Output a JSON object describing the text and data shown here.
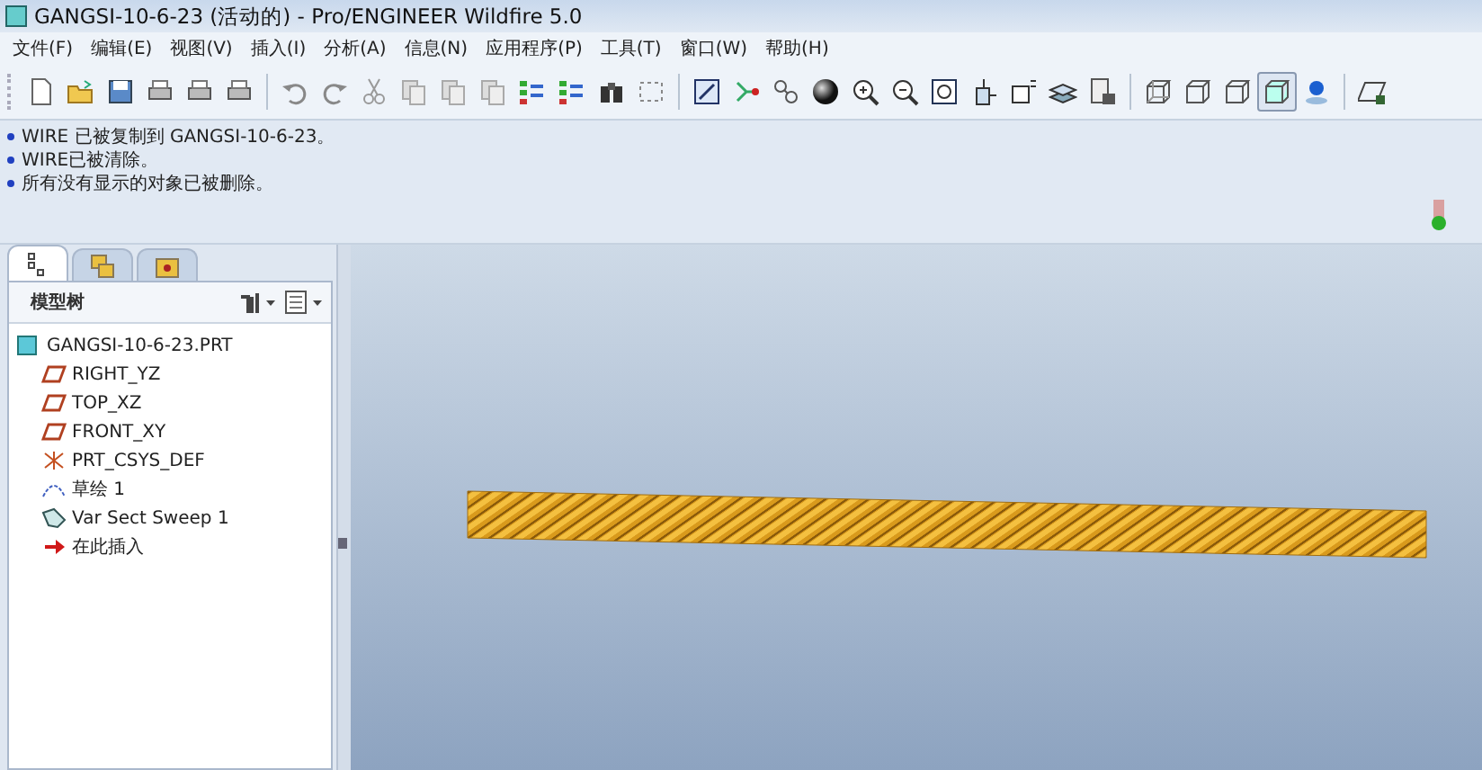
{
  "window": {
    "title": "GANGSI-10-6-23 (活动的) - Pro/ENGINEER Wildfire 5.0"
  },
  "menu": [
    "文件(F)",
    "编辑(E)",
    "视图(V)",
    "插入(I)",
    "分析(A)",
    "信息(N)",
    "应用程序(P)",
    "工具(T)",
    "窗口(W)",
    "帮助(H)"
  ],
  "display_styles": [
    {
      "selected": false
    },
    {
      "selected": false
    },
    {
      "selected": false
    },
    {
      "selected": true
    }
  ],
  "messages": [
    "WIRE 已被复制到 GANGSI-10-6-23。",
    "WIRE已被清除。",
    "所有没有显示的对象已被删除。"
  ],
  "navigator_tabs": [
    {
      "selected": true
    },
    {
      "selected": false
    },
    {
      "selected": false
    }
  ],
  "model_tree": {
    "title": "模型树",
    "items": [
      {
        "kind": "part",
        "label": "GANGSI-10-6-23.PRT",
        "children": [
          {
            "kind": "plane",
            "label": "RIGHT_YZ"
          },
          {
            "kind": "plane",
            "label": "TOP_XZ"
          },
          {
            "kind": "plane",
            "label": "FRONT_XY"
          },
          {
            "kind": "csys",
            "label": "PRT_CSYS_DEF"
          },
          {
            "kind": "sketch",
            "label": "草绘 1"
          },
          {
            "kind": "sweep",
            "label": "Var Sect Sweep 1"
          },
          {
            "kind": "insert",
            "label": "在此插入"
          }
        ]
      }
    ]
  }
}
